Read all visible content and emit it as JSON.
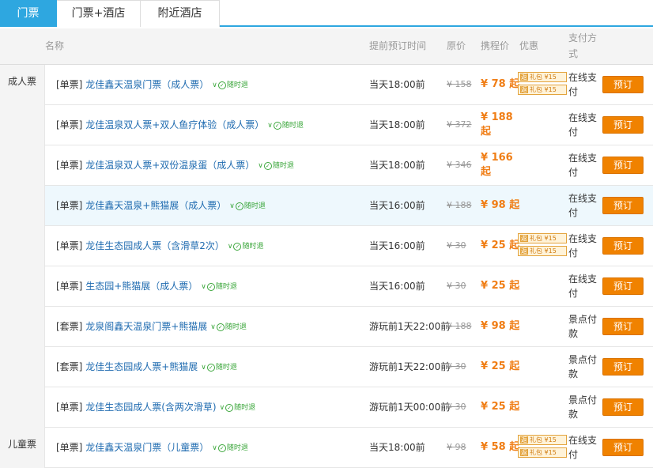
{
  "tabs": [
    "门票",
    "门票+酒店",
    "附近酒店"
  ],
  "header": {
    "name": "名称",
    "advance": "提前预订时间",
    "original": "原价",
    "ctrip": "携程价",
    "discount": "优惠",
    "payment": "支付方式"
  },
  "categories": [
    {
      "label": "成人票"
    },
    {
      "label": "儿童票"
    }
  ],
  "refund_label": "随时退",
  "promo_tag": "返",
  "promo_text": "礼包 ¥15",
  "rows": [
    {
      "type": "[单票]",
      "name": "龙佳鑫天温泉门票（成人票）",
      "time": "当天18:00前",
      "original": "¥ 158",
      "price": "¥ 78 起",
      "price2": "",
      "payment": "在线支付",
      "promo": true,
      "book": "预订"
    },
    {
      "type": "[单票]",
      "name": "龙佳温泉双人票+双人鱼疗体验（成人票）",
      "time": "当天18:00前",
      "original": "¥ 372",
      "price": "¥ 188",
      "price2": "起",
      "payment": "在线支付",
      "promo": false,
      "book": "预订"
    },
    {
      "type": "[单票]",
      "name": "龙佳温泉双人票+双份温泉蛋（成人票）",
      "time": "当天18:00前",
      "original": "¥ 346",
      "price": "¥ 166",
      "price2": "起",
      "payment": "在线支付",
      "promo": false,
      "book": "预订"
    },
    {
      "type": "[单票]",
      "name": "龙佳鑫天温泉+熊猫展（成人票）",
      "time": "当天16:00前",
      "original": "¥ 188",
      "price": "¥ 98 起",
      "price2": "",
      "payment": "在线支付",
      "promo": false,
      "book": "预订"
    },
    {
      "type": "[单票]",
      "name": "龙佳生态园成人票（含滑草2次）",
      "time": "当天16:00前",
      "original": "¥ 30",
      "price": "¥ 25 起",
      "price2": "",
      "payment": "在线支付",
      "promo": true,
      "book": "预订"
    },
    {
      "type": "[单票]",
      "name": "生态园+熊猫展（成人票）",
      "time": "当天16:00前",
      "original": "¥ 30",
      "price": "¥ 25 起",
      "price2": "",
      "payment": "在线支付",
      "promo": false,
      "book": "预订"
    },
    {
      "type": "[套票]",
      "name": "龙泉阁鑫天温泉门票+熊猫展",
      "time": "游玩前1天22:00前",
      "original": "¥ 188",
      "price": "¥ 98 起",
      "price2": "",
      "payment": "景点付款",
      "promo": false,
      "book": "预订"
    },
    {
      "type": "[套票]",
      "name": "龙佳生态园成人票+熊猫展",
      "time": "游玩前1天22:00前",
      "original": "¥ 30",
      "price": "¥ 25 起",
      "price2": "",
      "payment": "景点付款",
      "promo": false,
      "book": "预订"
    },
    {
      "type": "[单票]",
      "name": "龙佳生态园成人票(含两次滑草)",
      "time": "游玩前1天00:00前",
      "original": "¥ 30",
      "price": "¥ 25 起",
      "price2": "",
      "payment": "景点付款",
      "promo": false,
      "book": "预订"
    },
    {
      "type": "[单票]",
      "name": "龙佳鑫天温泉门票（儿童票）",
      "time": "当天18:00前",
      "original": "¥ 98",
      "price": "¥ 58 起",
      "price2": "",
      "payment": "在线支付",
      "promo": true,
      "book": "预订"
    }
  ],
  "colors": {
    "accent": "#2ea7e0",
    "price": "#f07e16",
    "button": "#f08200",
    "link": "#1f6bb0"
  }
}
